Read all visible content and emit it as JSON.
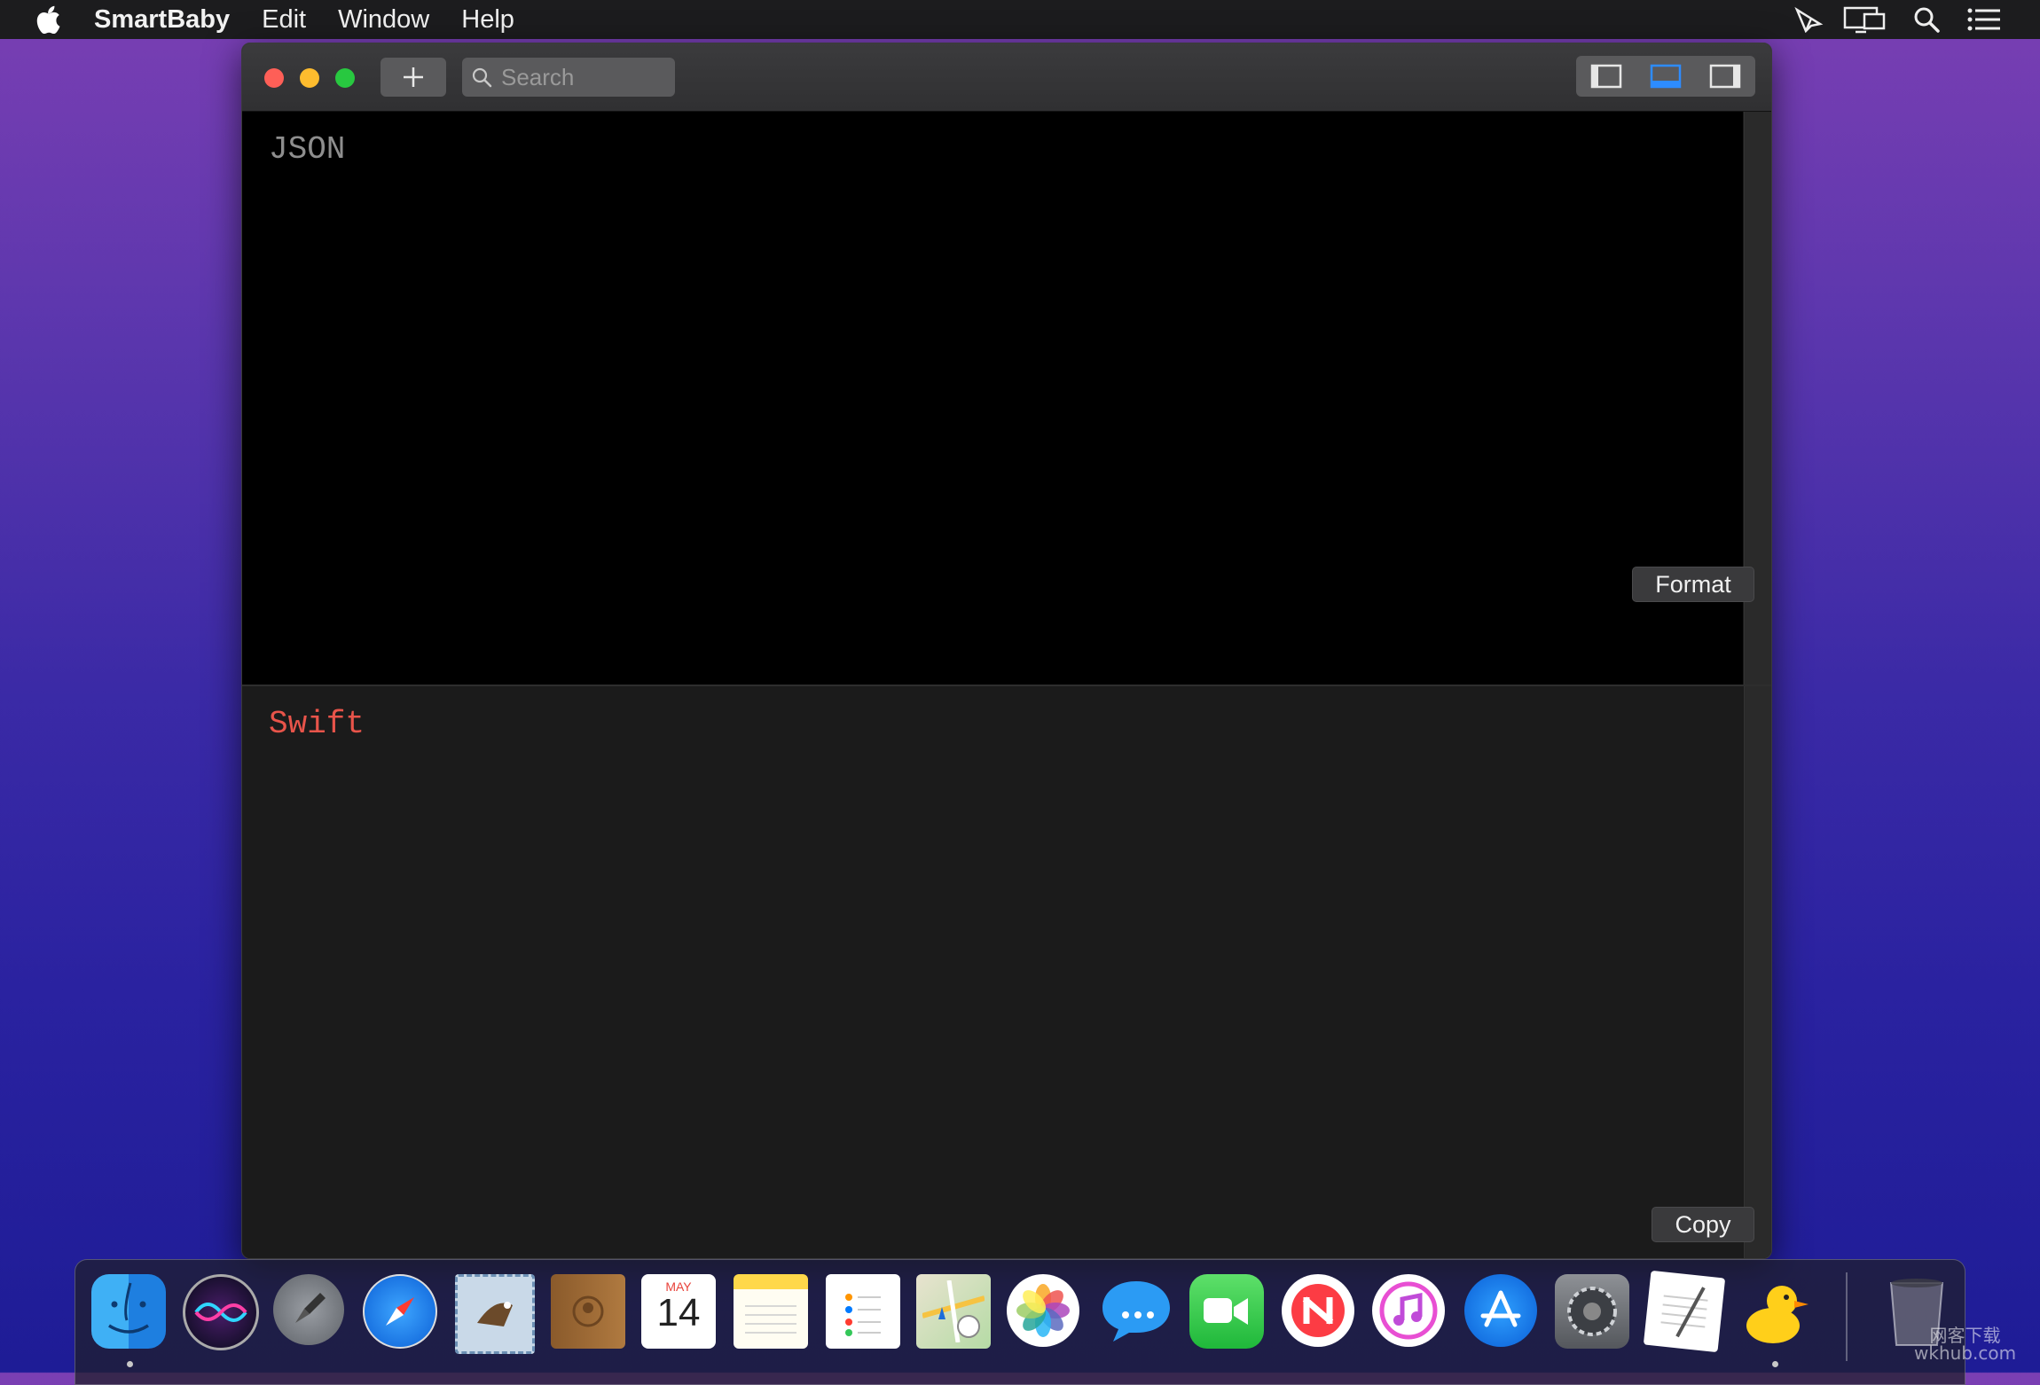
{
  "menubar": {
    "app_name": "SmartBaby",
    "items": [
      "Edit",
      "Window",
      "Help"
    ],
    "status_icons": [
      "airplay-icon",
      "display-mirror-icon",
      "spotlight-icon",
      "notification-center-icon"
    ]
  },
  "window": {
    "toolbar": {
      "add_icon": "plus-icon",
      "search_placeholder": "Search",
      "layout_buttons": [
        "layout-left-sidebar-icon",
        "layout-bottom-panel-icon",
        "layout-right-sidebar-icon"
      ],
      "active_layout": "layout-bottom-panel-icon"
    },
    "json_pane": {
      "label": "JSON",
      "button": "Format"
    },
    "swift_pane": {
      "label": "Swift",
      "button": "Copy"
    }
  },
  "dock": {
    "apps": [
      "Finder",
      "Siri",
      "Launchpad",
      "Safari",
      "Mail",
      "Contacts",
      "Calendar",
      "Notes",
      "Reminders",
      "Maps",
      "Photos",
      "Messages",
      "FaceTime",
      "News",
      "iTunes",
      "App Store",
      "System Preferences",
      "TextEdit",
      "SmartBaby"
    ],
    "calendar": {
      "month": "MAY",
      "day": "14"
    },
    "trash": "Trash"
  },
  "watermark": {
    "line1": "网客下载",
    "line2": "wkhub.com"
  },
  "colors": {
    "accent": "#2d8cff",
    "swift_label": "#e8544a",
    "json_label": "#8e8e8e",
    "close": "#fe5f57",
    "minimize": "#febc2e",
    "maximize": "#28c840"
  }
}
